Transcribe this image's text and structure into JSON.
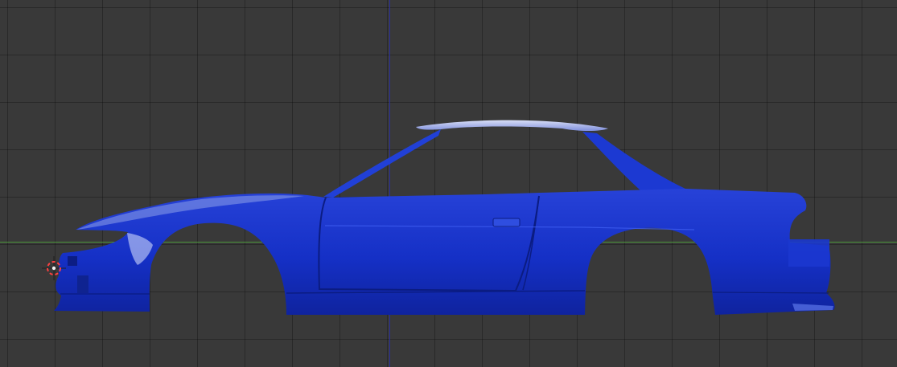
{
  "viewport": {
    "background_color": "#393939",
    "grid_color": "#2f2f2f",
    "x_axis_color": "#4d9a3a",
    "z_axis_color": "#2b2fa0"
  },
  "model": {
    "body_color": "#1530c6",
    "highlight_color": "#c9d2f0"
  },
  "icons": {
    "cursor": "3d-cursor-icon"
  }
}
